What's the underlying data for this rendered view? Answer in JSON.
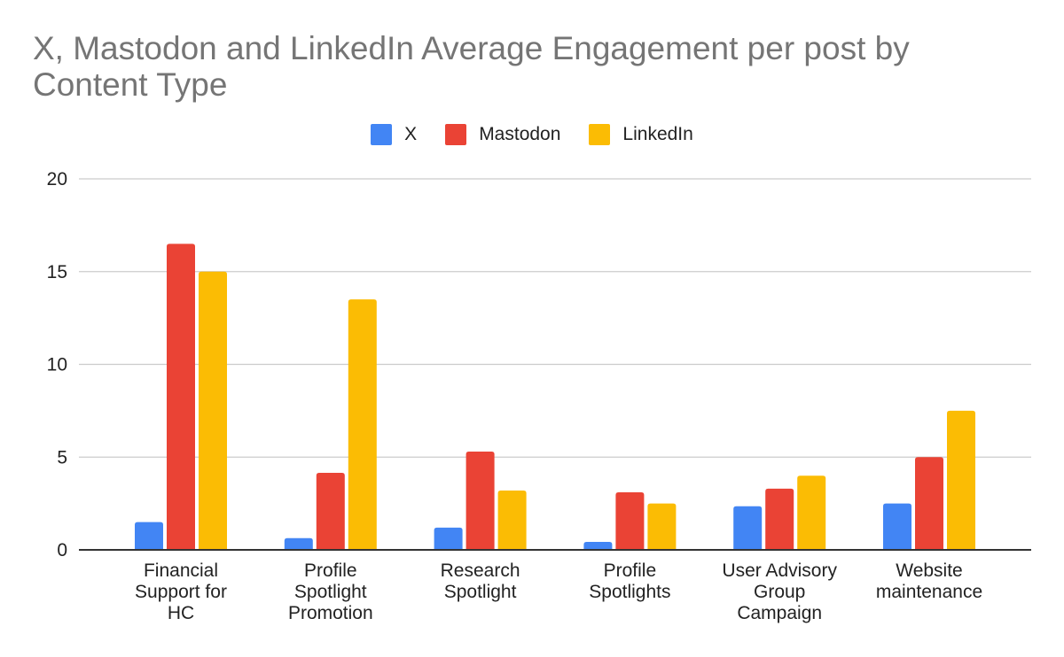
{
  "chart_data": {
    "type": "bar",
    "title": "X, Mastodon and LinkedIn Average Engagement per post by Content Type",
    "title_lines": [
      "X, Mastodon and LinkedIn Average Engagement per post by",
      "Content Type"
    ],
    "xlabel": "",
    "ylabel": "",
    "ylim": [
      0,
      20
    ],
    "yticks": [
      0,
      5,
      10,
      15,
      20
    ],
    "grid": true,
    "legend_position": "top",
    "categories": [
      [
        "Financial",
        "Support for",
        "HC"
      ],
      [
        "Profile",
        "Spotlight",
        "Promotion"
      ],
      [
        "Research",
        "Spotlight"
      ],
      [
        "Profile",
        "Spotlights"
      ],
      [
        "User Advisory",
        "Group",
        "Campaign"
      ],
      [
        "Website",
        "maintenance"
      ]
    ],
    "category_names": [
      "Financial Support for HC",
      "Profile Spotlight Promotion",
      "Research Spotlight",
      "Profile Spotlights",
      "User Advisory Group Campaign",
      "Website maintenance"
    ],
    "series": [
      {
        "name": "X",
        "color": "#4285f4",
        "values": [
          1.5,
          0.63,
          1.2,
          0.43,
          2.35,
          2.5
        ]
      },
      {
        "name": "Mastodon",
        "color": "#ea4335",
        "values": [
          16.5,
          4.15,
          5.3,
          3.1,
          3.3,
          5.0
        ]
      },
      {
        "name": "LinkedIn",
        "color": "#fbbc04",
        "values": [
          15.0,
          13.5,
          3.2,
          2.5,
          4.0,
          7.5
        ]
      }
    ]
  }
}
